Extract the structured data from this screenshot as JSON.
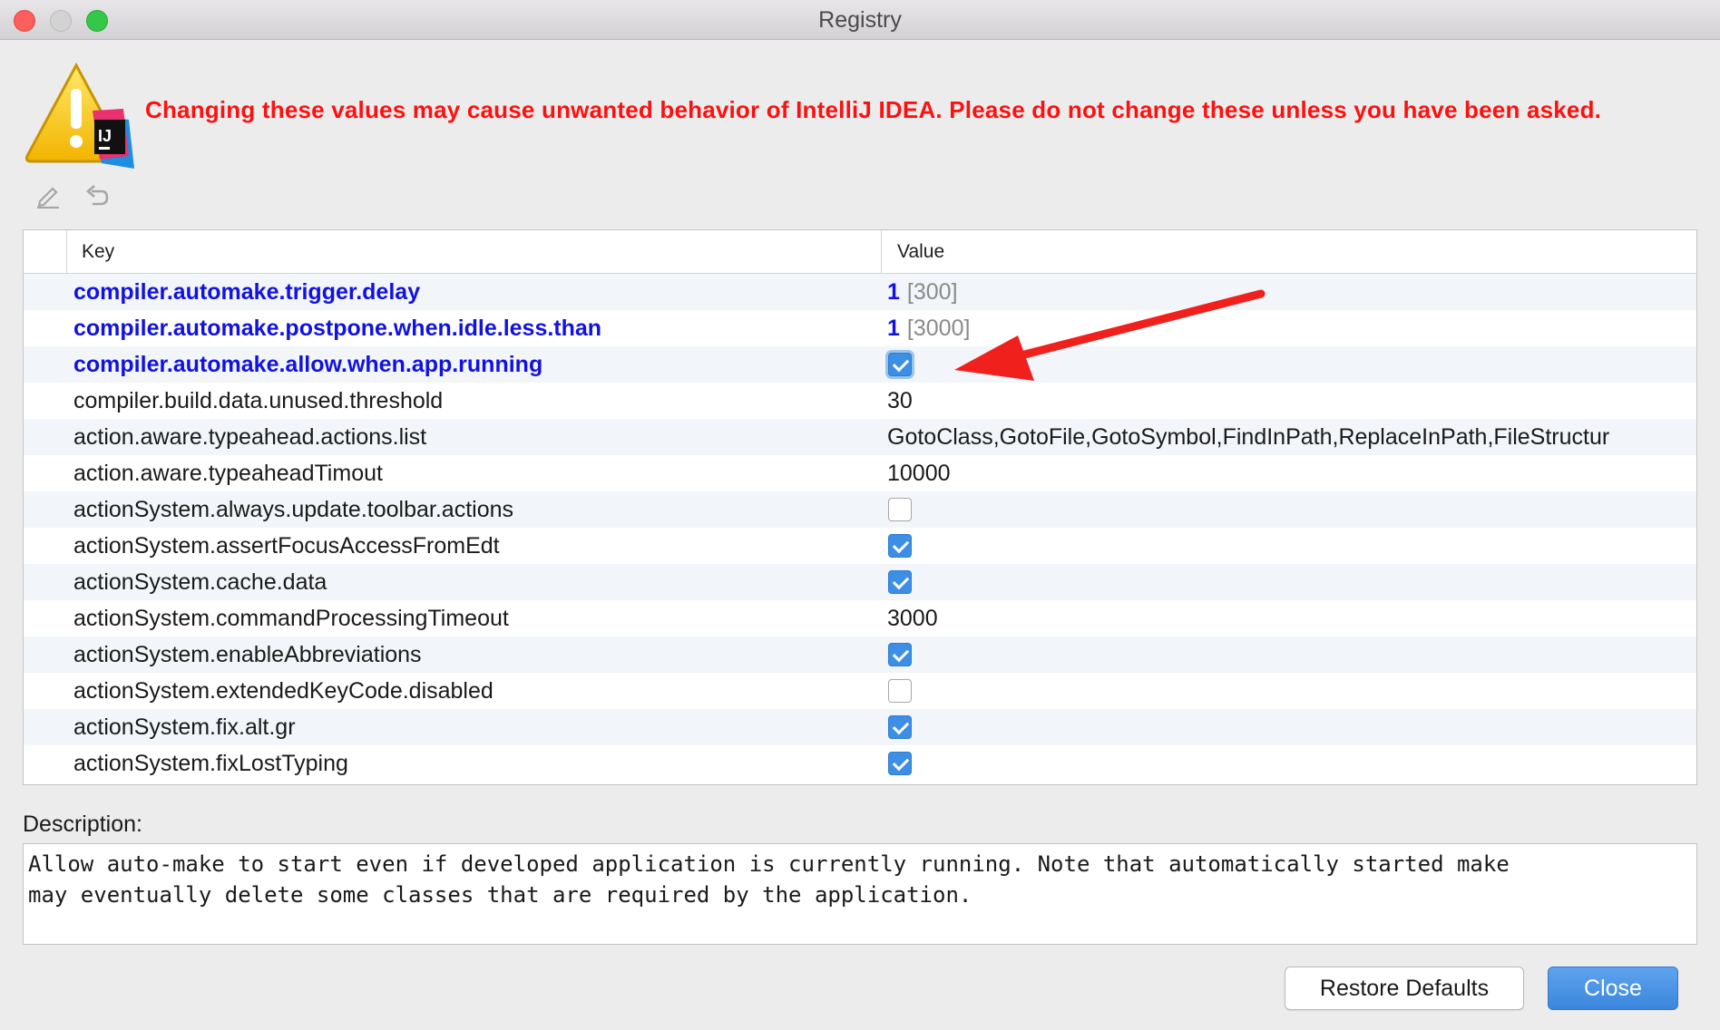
{
  "window": {
    "title": "Registry"
  },
  "warning": {
    "text": "Changing these values may cause unwanted behavior of IntelliJ IDEA. Please do not change these unless you have been asked."
  },
  "toolbar": {
    "edit_icon": "edit-pencil-icon",
    "revert_icon": "undo-arrow-icon"
  },
  "table": {
    "headers": {
      "key": "Key",
      "value": "Value"
    },
    "rows": [
      {
        "key": "compiler.automake.trigger.delay",
        "value": "1",
        "default": "[300]",
        "type": "text",
        "changed": true
      },
      {
        "key": "compiler.automake.postpone.when.idle.less.than",
        "value": "1",
        "default": "[3000]",
        "type": "text",
        "changed": true
      },
      {
        "key": "compiler.automake.allow.when.app.running",
        "checked": true,
        "type": "checkbox",
        "changed": true
      },
      {
        "key": "compiler.build.data.unused.threshold",
        "value": "30",
        "type": "text"
      },
      {
        "key": "action.aware.typeahead.actions.list",
        "value": "GotoClass,GotoFile,GotoSymbol,FindInPath,ReplaceInPath,FileStructur",
        "type": "text"
      },
      {
        "key": "action.aware.typeaheadTimout",
        "value": "10000",
        "type": "text"
      },
      {
        "key": "actionSystem.always.update.toolbar.actions",
        "checked": false,
        "type": "checkbox"
      },
      {
        "key": "actionSystem.assertFocusAccessFromEdt",
        "checked": true,
        "type": "checkbox"
      },
      {
        "key": "actionSystem.cache.data",
        "checked": true,
        "type": "checkbox"
      },
      {
        "key": "actionSystem.commandProcessingTimeout",
        "value": "3000",
        "type": "text"
      },
      {
        "key": "actionSystem.enableAbbreviations",
        "checked": true,
        "type": "checkbox"
      },
      {
        "key": "actionSystem.extendedKeyCode.disabled",
        "checked": false,
        "type": "checkbox"
      },
      {
        "key": "actionSystem.fix.alt.gr",
        "checked": true,
        "type": "checkbox"
      },
      {
        "key": "actionSystem.fixLostTyping",
        "checked": true,
        "type": "checkbox"
      }
    ]
  },
  "description": {
    "label": "Description:",
    "text": "Allow auto-make to start even if developed application is currently running. Note that automatically started make\nmay eventually delete some classes that are required by the application."
  },
  "buttons": {
    "restore": "Restore Defaults",
    "close": "Close"
  },
  "colors": {
    "changed_key": "#1212e0",
    "warning": "#ff1010",
    "checkbox_on": "#3d8fe6",
    "annotation_arrow": "#f0201c"
  }
}
